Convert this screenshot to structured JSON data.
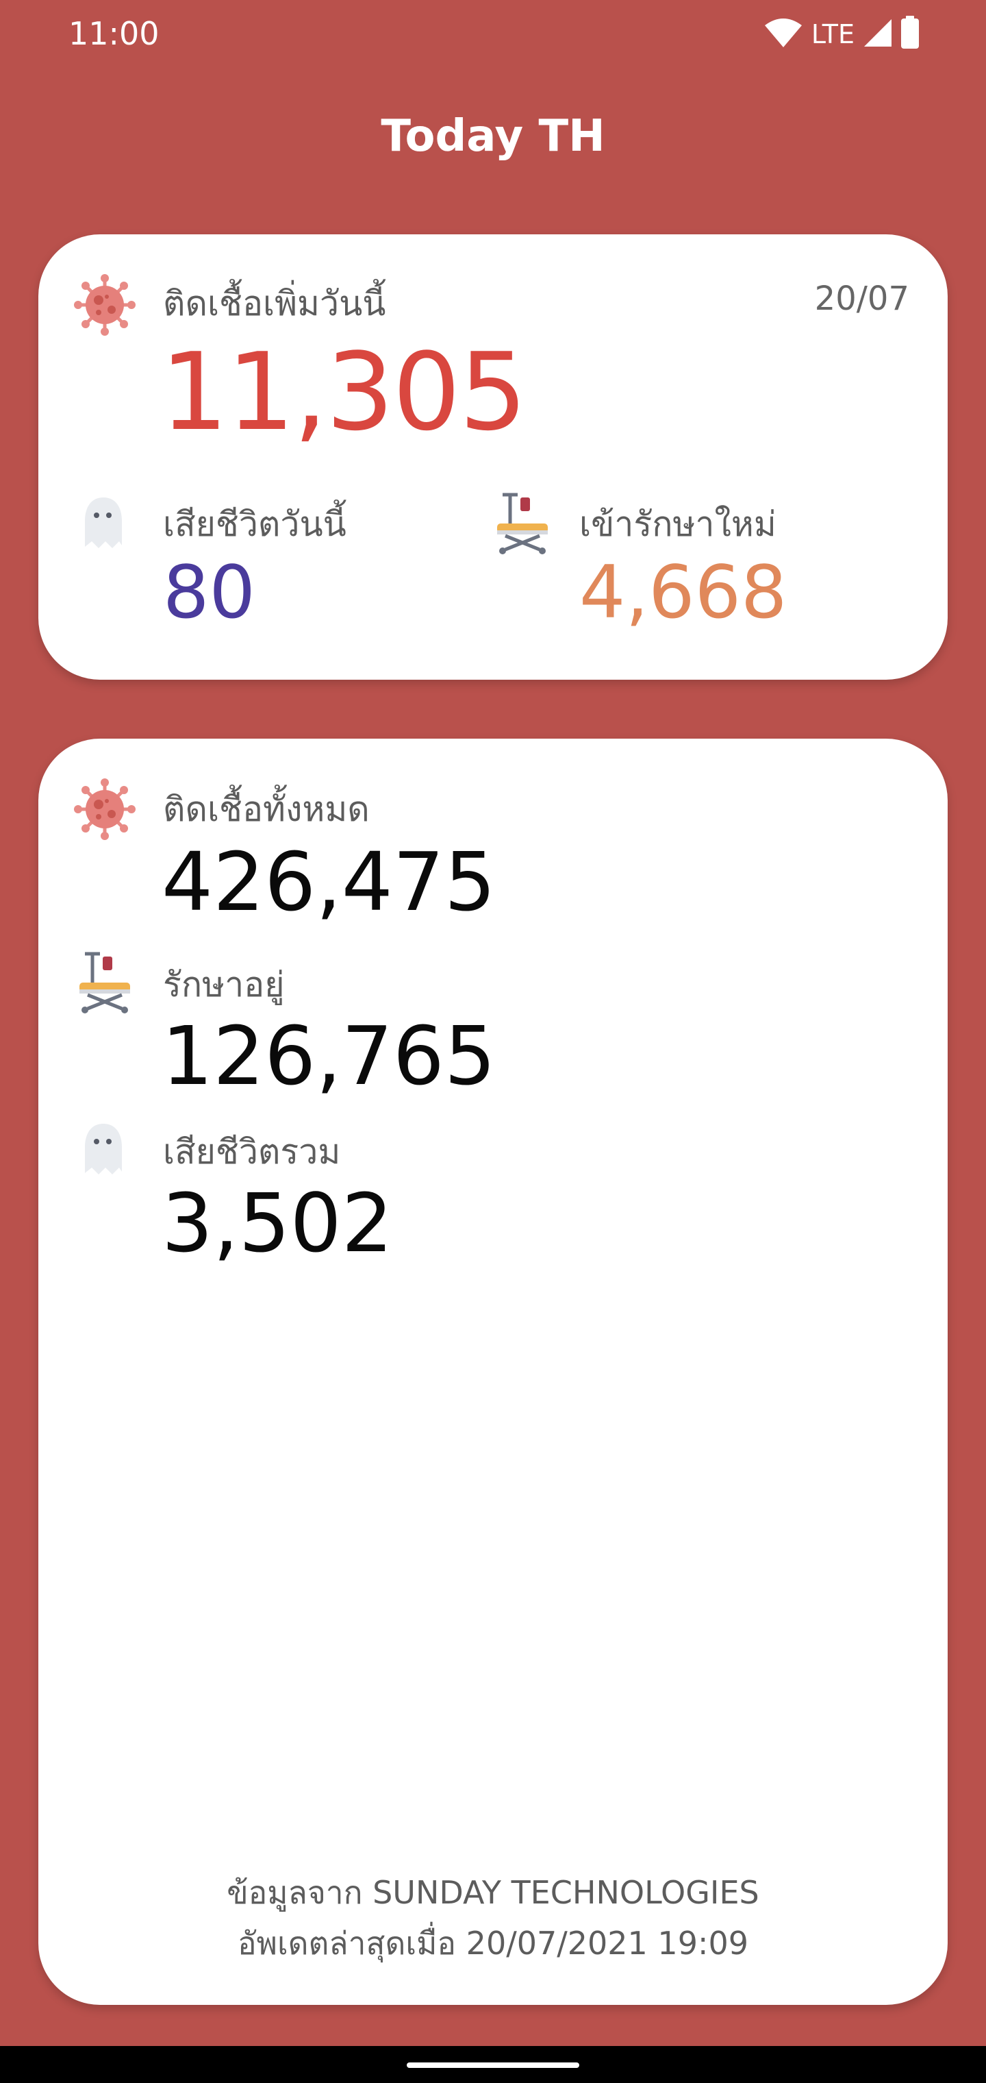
{
  "status_bar": {
    "time": "11:00",
    "network": "LTE",
    "icons": [
      "wifi-icon",
      "cell-signal-icon",
      "battery-icon"
    ]
  },
  "app": {
    "title": "Today TH"
  },
  "today": {
    "date": "20/07",
    "new_cases_label": "ติดเชื้อเพิ่มวันนี้",
    "new_cases_value": "11,305",
    "deaths_label": "เสียชีวิตวันนี้",
    "deaths_value": "80",
    "hospitalized_label": "เข้ารักษาใหม่",
    "hospitalized_value": "4,668"
  },
  "totals": {
    "cases_label": "ติดเชื้อทั้งหมด",
    "cases_value": "426,475",
    "treating_label": "รักษาอยู่",
    "treating_value": "126,765",
    "deaths_label": "เสียชีวิตรวม",
    "deaths_value": "3,502"
  },
  "footer": {
    "source": "ข้อมูลจาก SUNDAY TECHNOLOGIES",
    "updated": "อัพเดตล่าสุดเมื่อ 20/07/2021 19:09"
  },
  "colors": {
    "background": "#b9514c",
    "new_cases": "#d9473f",
    "deaths_today": "#4a3b9c",
    "hospitalized_today": "#e0885a"
  }
}
